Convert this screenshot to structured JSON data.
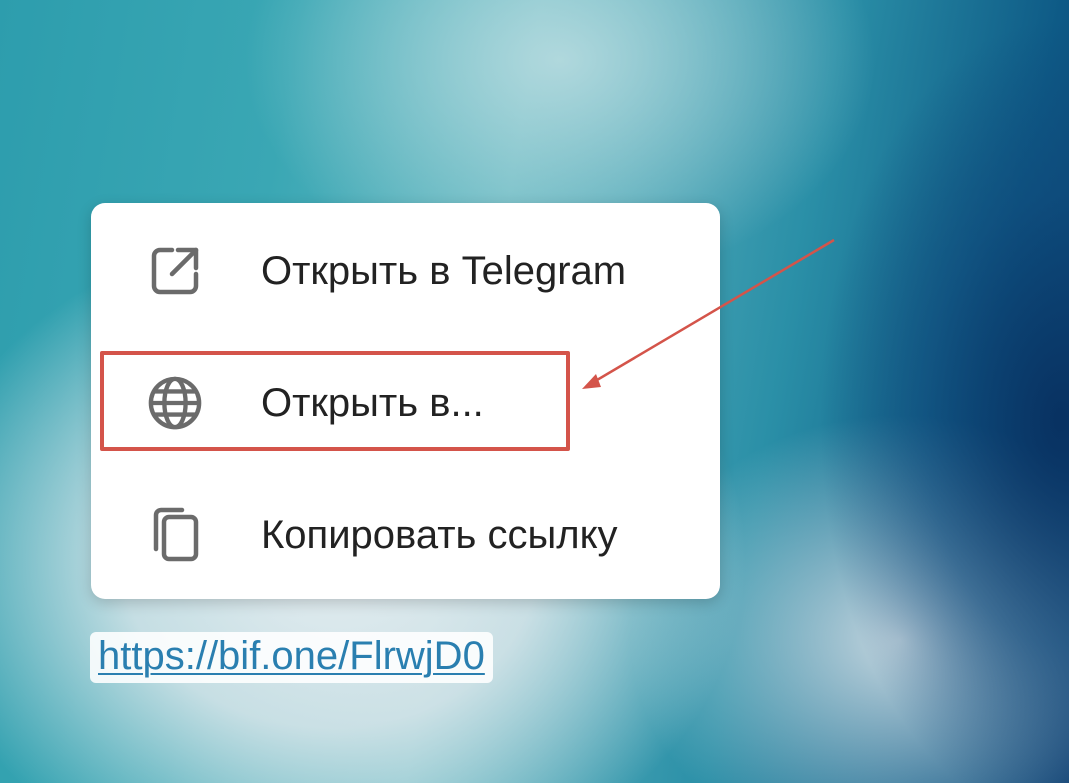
{
  "context_menu": {
    "items": [
      {
        "label": "Открыть в Telegram",
        "icon": "open-external-icon"
      },
      {
        "label": "Открыть в...",
        "icon": "globe-icon"
      },
      {
        "label": "Копировать ссылку",
        "icon": "copy-icon"
      }
    ]
  },
  "annotation": {
    "highlight_color": "#d4544a",
    "highlighted_item": "Открыть в..."
  },
  "link": {
    "text": "https://bif.one/FlrwjD0",
    "color": "#2a7fb0"
  }
}
